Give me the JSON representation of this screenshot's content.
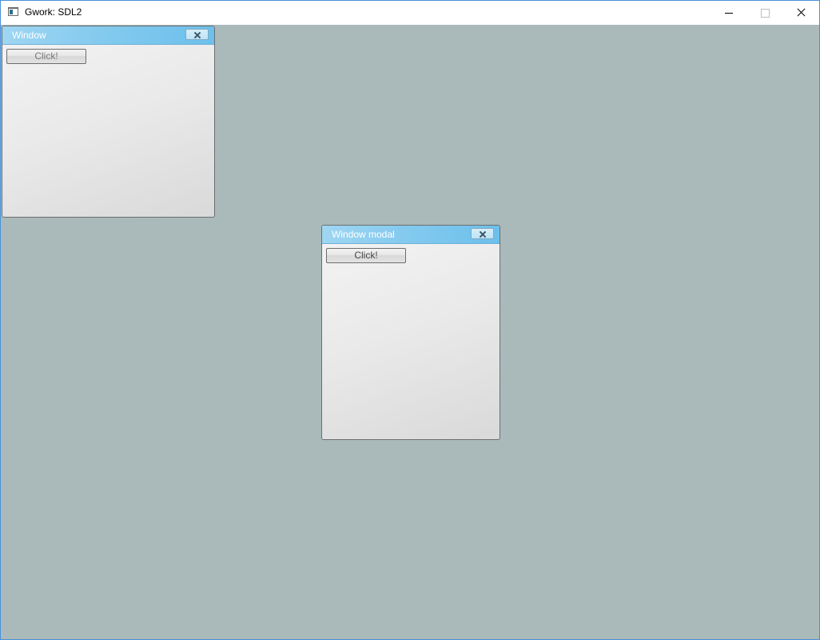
{
  "app": {
    "title": "Gwork: SDL2",
    "icon": "app-window-icon"
  },
  "titlebar_controls": [
    "minimize-icon",
    "maximize-icon",
    "close-icon"
  ],
  "windows": [
    {
      "title": "Window",
      "button_label": "Click!"
    },
    {
      "title": "Window modal",
      "button_label": "Click!"
    }
  ],
  "colors": {
    "desktop_bg": "#aababa",
    "titlebar_accent": "#82c9ee",
    "os_border": "#4a90d9"
  }
}
